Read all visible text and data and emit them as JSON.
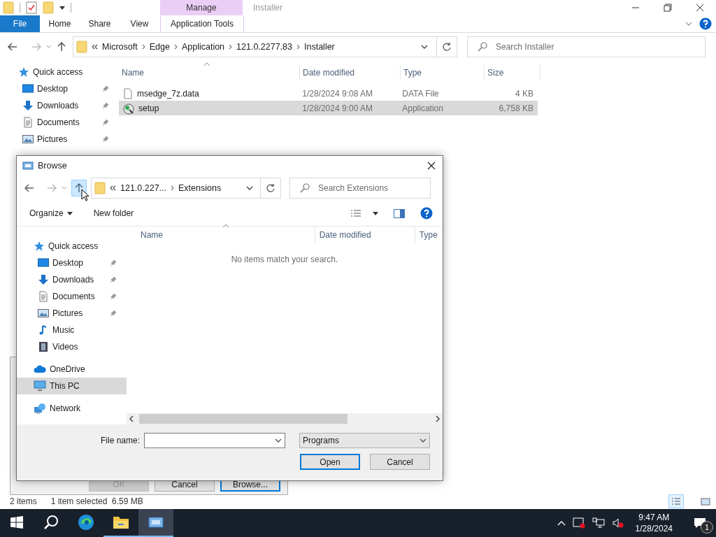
{
  "explorer": {
    "context_group": "Manage",
    "title": "Installer",
    "ribbon_tabs": [
      {
        "label": "File",
        "kind": "file"
      },
      {
        "label": "Home",
        "kind": "plain"
      },
      {
        "label": "Share",
        "kind": "plain"
      },
      {
        "label": "View",
        "kind": "plain"
      },
      {
        "label": "Application Tools",
        "kind": "context"
      }
    ],
    "address": [
      "Microsoft",
      "Edge",
      "Application",
      "121.0.2277.83",
      "Installer"
    ],
    "search_placeholder": "Search Installer",
    "nav": [
      {
        "label": "Quick access",
        "kind": "star",
        "pinned": false,
        "children": [
          {
            "label": "Desktop",
            "kind": "desktop",
            "pinned": true
          },
          {
            "label": "Downloads",
            "kind": "download",
            "pinned": true
          },
          {
            "label": "Documents",
            "kind": "document",
            "pinned": true
          },
          {
            "label": "Pictures",
            "kind": "pictures",
            "pinned": true
          }
        ]
      }
    ],
    "columns": [
      "Name",
      "Date modified",
      "Type",
      "Size"
    ],
    "files": [
      {
        "name": "msedge_7z.data",
        "date": "1/28/2024 9:08 AM",
        "type": "DATA File",
        "size": "4 KB",
        "kind": "data",
        "selected": false
      },
      {
        "name": "setup",
        "date": "1/28/2024 9:00 AM",
        "type": "Application",
        "size": "6,758 KB",
        "kind": "app",
        "selected": true
      }
    ],
    "status": [
      "2 items",
      "1 item selected  6.59 MB"
    ]
  },
  "run_dialog": {
    "buttons": [
      {
        "label": "OK",
        "disabled": true,
        "default": false
      },
      {
        "label": "Cancel",
        "disabled": false,
        "default": false
      },
      {
        "label": "Browse...",
        "disabled": false,
        "default": true
      }
    ]
  },
  "browse_dialog": {
    "title": "Browse",
    "address": [
      "121.0.227...",
      "Extensions"
    ],
    "search_placeholder": "Search Extensions",
    "toolbar": [
      "Organize",
      "New folder"
    ],
    "nav": [
      {
        "label": "Quick access",
        "kind": "star",
        "pinned": false,
        "selected": false,
        "children": [
          {
            "label": "Desktop",
            "kind": "desktop",
            "pinned": true,
            "selected": false
          },
          {
            "label": "Downloads",
            "kind": "download",
            "pinned": true,
            "selected": false
          },
          {
            "label": "Documents",
            "kind": "document",
            "pinned": true,
            "selected": false
          },
          {
            "label": "Pictures",
            "kind": "pictures",
            "pinned": true,
            "selected": false
          },
          {
            "label": "Music",
            "kind": "music",
            "pinned": false,
            "selected": false
          },
          {
            "label": "Videos",
            "kind": "videos",
            "pinned": false,
            "selected": false
          }
        ]
      },
      {
        "label": "OneDrive",
        "kind": "cloud",
        "pinned": false,
        "selected": false
      },
      {
        "label": "This PC",
        "kind": "pc",
        "pinned": false,
        "selected": true
      },
      {
        "label": "Network",
        "kind": "network",
        "pinned": false,
        "selected": false
      }
    ],
    "columns": [
      "Name",
      "Date modified",
      "Type"
    ],
    "empty_message": "No items match your search.",
    "file_name_label": "File name:",
    "file_type": "Programs",
    "buttons": [
      "Open",
      "Cancel"
    ]
  },
  "taskbar": {
    "apps": [
      {
        "kind": "search",
        "active": false,
        "running": false
      },
      {
        "kind": "edge",
        "active": false,
        "running": false
      },
      {
        "kind": "explorer",
        "active": false,
        "running": true
      },
      {
        "kind": "run",
        "active": true,
        "running": true
      }
    ],
    "time": "9:47 AM",
    "date": "1/28/2024",
    "notifications": "1"
  }
}
